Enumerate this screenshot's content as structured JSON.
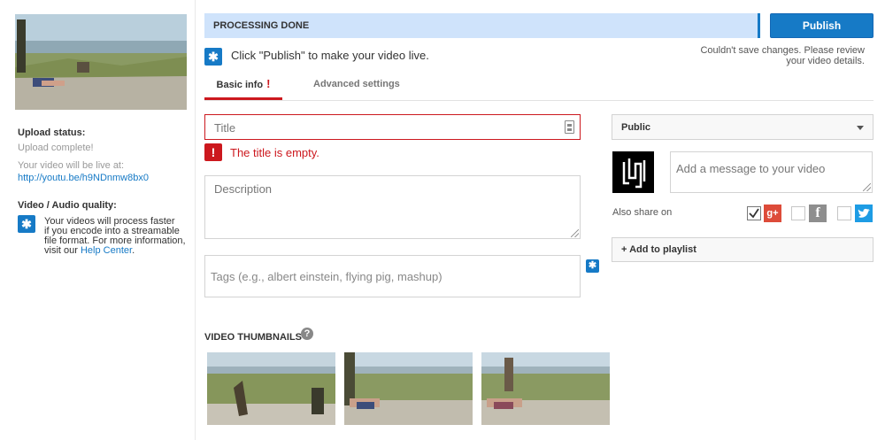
{
  "sidebar": {
    "upload_status_label": "Upload status:",
    "upload_status_value": "Upload complete!",
    "live_at_label": "Your video will be live at:",
    "video_url": "http://youtu.be/h9NDnmw8bx0",
    "quality_label": "Video / Audio quality:",
    "quality_text_1": "Your videos will process faster",
    "quality_text_2": "if you encode into a streamable",
    "quality_text_3": "file format. For more information,",
    "quality_text_4": "visit our",
    "help_center_link": "Help Center",
    "quality_text_end": "."
  },
  "status_bar": {
    "text": "PROCESSING DONE",
    "accent": "#167ac6",
    "background": "#cfe3fb"
  },
  "publish_button": {
    "label": "Publish"
  },
  "save_error": {
    "line1": "Couldn't save changes. Please review",
    "line2": "your video details."
  },
  "publish_hint": "Click \"Publish\" to make your video live.",
  "tabs": [
    {
      "label": "Basic info",
      "active": true,
      "error_mark": "!"
    },
    {
      "label": "Advanced settings",
      "active": false
    }
  ],
  "form": {
    "title_placeholder": "Title",
    "title_error": "The title is empty.",
    "error_glyph": "!",
    "description_placeholder": "Description",
    "tags_placeholder": "Tags (e.g., albert einstein, flying pig, mashup)"
  },
  "thumbnails": {
    "heading": "VIDEO THUMBNAILS",
    "help_glyph": "?"
  },
  "privacy": {
    "selected": "Public"
  },
  "share": {
    "message_placeholder": "Add a message to your video",
    "also_share_label": "Also share on",
    "networks": [
      {
        "name": "google-plus",
        "glyph": "g+",
        "checked": true
      },
      {
        "name": "facebook",
        "glyph": "f",
        "checked": false
      },
      {
        "name": "twitter",
        "glyph": "t",
        "checked": false
      }
    ]
  },
  "playlist": {
    "label": "+ Add to playlist"
  },
  "icons": {
    "info": "info-star-icon",
    "error": "error-exclamation-icon",
    "help": "help-question-icon"
  },
  "colors": {
    "error_red": "#cc181e",
    "link_blue": "#167ac6",
    "gplus_red": "#dd4b39",
    "twitter_blue": "#1e9ce4"
  }
}
